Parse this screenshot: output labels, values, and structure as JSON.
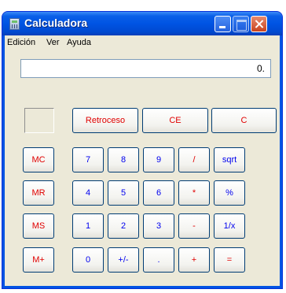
{
  "window": {
    "title": "Calculadora",
    "icon": "calculator-icon",
    "title_color": "#0054e3"
  },
  "menu": [
    "Edición",
    "Ver",
    "Ayuda"
  ],
  "display": {
    "value": "0."
  },
  "buttons": {
    "backspace": "Retroceso",
    "ce": "CE",
    "c": "C",
    "mc": "MC",
    "mr": "MR",
    "ms": "MS",
    "mplus": "M+",
    "n7": "7",
    "n8": "8",
    "n9": "9",
    "div": "/",
    "sqrt": "sqrt",
    "n4": "4",
    "n5": "5",
    "n6": "6",
    "mul": "*",
    "pct": "%",
    "n1": "1",
    "n2": "2",
    "n3": "3",
    "sub": "-",
    "inv": "1/x",
    "n0": "0",
    "sign": "+/-",
    "dot": ".",
    "add": "+",
    "eq": "="
  },
  "colors": {
    "red_label": "#e00000",
    "blue_label": "#0000ee",
    "face": "#ece9d8"
  }
}
